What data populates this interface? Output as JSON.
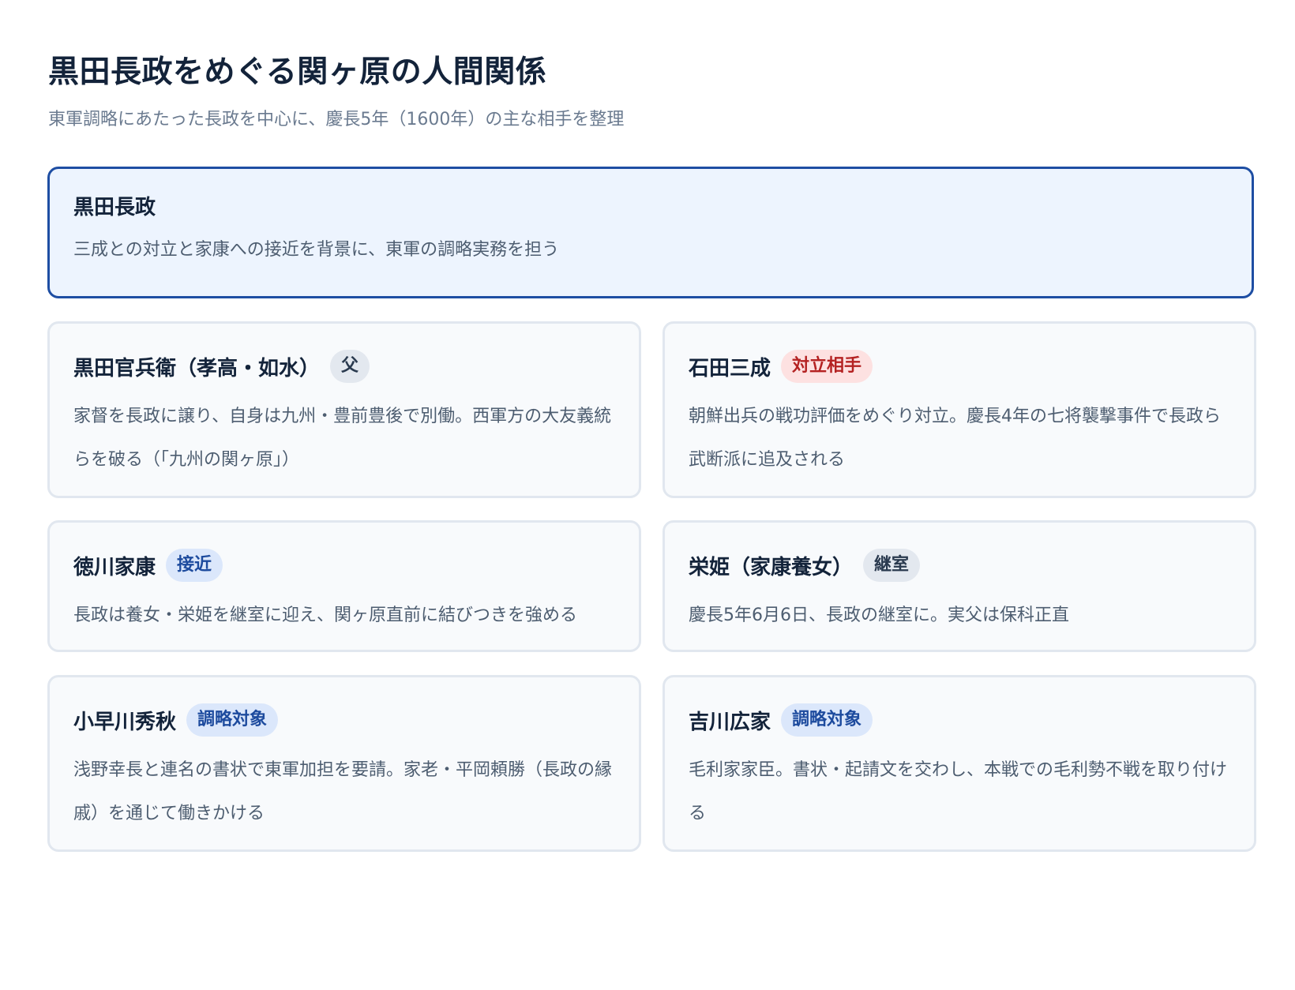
{
  "header": {
    "title": "黒田長政をめぐる関ヶ原の人間関係",
    "subtitle": "東軍調略にあたった長政を中心に、慶長5年（1600年）の主な相手を整理"
  },
  "center": {
    "name": "黒田長政",
    "description": "三成との対立と家康への接近を背景に、東軍の調略実務を担う"
  },
  "people": [
    {
      "name": "黒田官兵衛（孝高・如水）",
      "badge": "父",
      "description": "家督を長政に譲り、自身は九州・豊前豊後で別働。西軍方の大友義統らを破る（「九州の関ヶ原」）"
    },
    {
      "name": "石田三成",
      "badge": "対立相手",
      "description": "朝鮮出兵の戦功評価をめぐり対立。慶長4年の七将襲撃事件で長政ら武断派に追及される"
    },
    {
      "name": "徳川家康",
      "badge": "接近",
      "description": "長政は養女・栄姫を継室に迎え、関ヶ原直前に結びつきを強める"
    },
    {
      "name": "栄姫（家康養女）",
      "badge": "継室",
      "description": "慶長5年6月6日、長政の継室に。実父は保科正直"
    },
    {
      "name": "小早川秀秋",
      "badge": "調略対象",
      "description": "浅野幸長と連名の書状で東軍加担を要請。家老・平岡頼勝（長政の縁戚）を通じて働きかける"
    },
    {
      "name": "吉川広家",
      "badge": "調略対象",
      "description": "毛利家家臣。書状・起請文を交わし、本戦での毛利勢不戦を取り付ける"
    }
  ],
  "colors": {
    "focus_border": "#1e4ea3",
    "focus_background": "#edf4fe",
    "badge_neutral": "#e3e8ef",
    "badge_conflict": "#fde1e1",
    "badge_conflict_text": "#b42222",
    "badge_strategy": "#dbe7fb",
    "badge_strategy_text": "#1d4b9e"
  }
}
